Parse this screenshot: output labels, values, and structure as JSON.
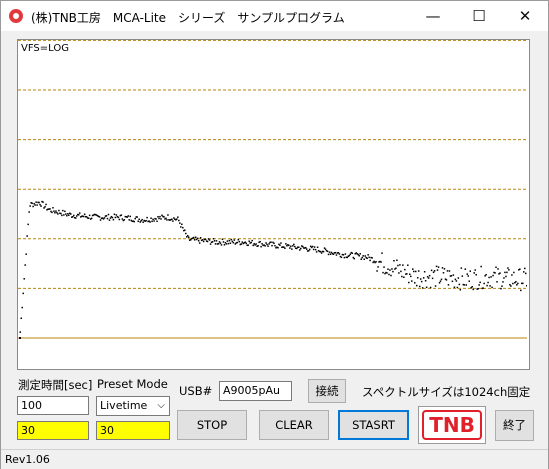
{
  "window": {
    "title": "(株)TNB工房　MCA-Lite　シリーズ　サンプルプログラム",
    "minimize_glyph": "—",
    "maximize_glyph": "☐",
    "close_glyph": "✕"
  },
  "plot": {
    "vfs_label": "VFS=LOG",
    "gridline_color": "#b8860b",
    "point_color": "#000000"
  },
  "chart_data": {
    "type": "scatter",
    "scale": "log",
    "channels": 1024,
    "decades": 6,
    "grid": "dashed horizontal, one per decade",
    "series": [
      {
        "values": [
          {
            "x": 0,
            "y": 0.0
          },
          {
            "x": 20,
            "y": 2.7
          },
          {
            "x": 40,
            "y": 2.75
          },
          {
            "x": 60,
            "y": 2.6
          },
          {
            "x": 80,
            "y": 2.55
          },
          {
            "x": 100,
            "y": 2.5
          },
          {
            "x": 150,
            "y": 2.45
          },
          {
            "x": 200,
            "y": 2.45
          },
          {
            "x": 250,
            "y": 2.4
          },
          {
            "x": 300,
            "y": 2.45
          },
          {
            "x": 320,
            "y": 2.4
          },
          {
            "x": 340,
            "y": 2.0
          },
          {
            "x": 400,
            "y": 1.95
          },
          {
            "x": 450,
            "y": 1.95
          },
          {
            "x": 500,
            "y": 1.9
          },
          {
            "x": 550,
            "y": 1.85
          },
          {
            "x": 600,
            "y": 1.8
          },
          {
            "x": 650,
            "y": 1.7
          },
          {
            "x": 700,
            "y": 1.65
          },
          {
            "x": 750,
            "y": 1.45
          },
          {
            "x": 800,
            "y": 1.25
          },
          {
            "x": 850,
            "y": 1.25
          },
          {
            "x": 900,
            "y": 1.2
          },
          {
            "x": 950,
            "y": 1.25
          },
          {
            "x": 1000,
            "y": 1.2
          },
          {
            "x": 1023,
            "y": 1.2
          }
        ]
      }
    ]
  },
  "controls": {
    "measure_time_label": "測定時間[sec]",
    "preset_mode_label": "Preset Mode",
    "time_input_value": "100",
    "time_display_value": "30",
    "preset_mode_value": "Livetime",
    "preset_display_value": "30",
    "usb_label": "USB#",
    "usb_value": "A9005pAu",
    "connect_label": "接続",
    "spectrum_size_label": "スペクトルサイズは1024ch固定",
    "stop_label": "STOP",
    "clear_label": "CLEAR",
    "start_label": "STASRT",
    "tnb_logo": "TNB",
    "exit_label": "終了",
    "highlight_color": "#ffff00"
  },
  "status": {
    "version": "Rev1.06"
  }
}
